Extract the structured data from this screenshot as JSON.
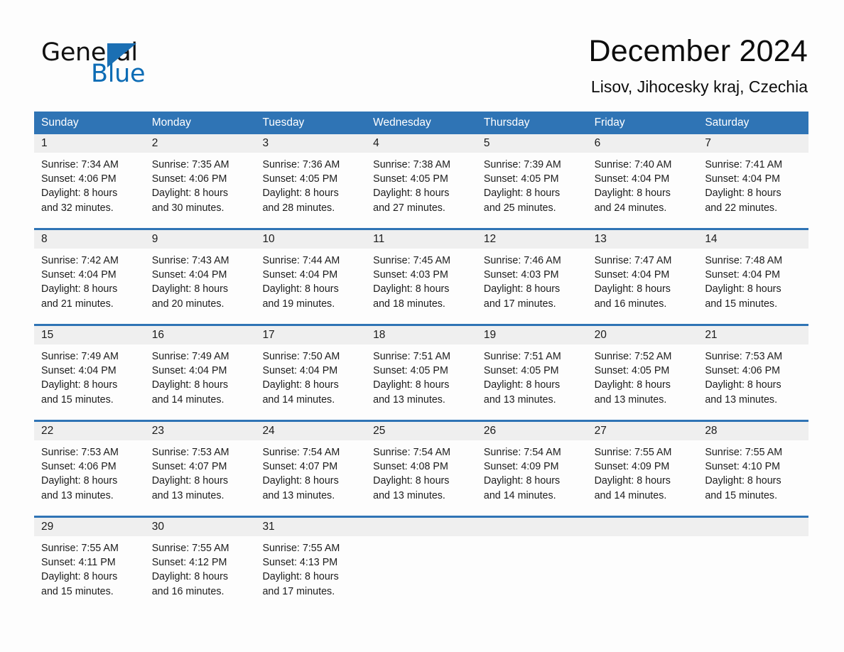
{
  "brand": {
    "name_part1": "General",
    "name_part2": "Blue",
    "triangle_color": "#1b6fb3",
    "blue_color": "#0d6cb5"
  },
  "header": {
    "month_title": "December 2024",
    "location": "Lisov, Jihocesky kraj, Czechia"
  },
  "theme": {
    "header_blue": "#2f74b5",
    "row_divider_blue": "#2f74b5",
    "daynum_strip_gray": "#efefef",
    "page_background": "#fdfdfd",
    "text_color": "#1c1c1c"
  },
  "calendar": {
    "weekday_headers": [
      "Sunday",
      "Monday",
      "Tuesday",
      "Wednesday",
      "Thursday",
      "Friday",
      "Saturday"
    ],
    "weeks": [
      [
        {
          "day": "1",
          "sunrise": "Sunrise: 7:34 AM",
          "sunset": "Sunset: 4:06 PM",
          "daylight_line1": "Daylight: 8 hours",
          "daylight_line2": "and 32 minutes."
        },
        {
          "day": "2",
          "sunrise": "Sunrise: 7:35 AM",
          "sunset": "Sunset: 4:06 PM",
          "daylight_line1": "Daylight: 8 hours",
          "daylight_line2": "and 30 minutes."
        },
        {
          "day": "3",
          "sunrise": "Sunrise: 7:36 AM",
          "sunset": "Sunset: 4:05 PM",
          "daylight_line1": "Daylight: 8 hours",
          "daylight_line2": "and 28 minutes."
        },
        {
          "day": "4",
          "sunrise": "Sunrise: 7:38 AM",
          "sunset": "Sunset: 4:05 PM",
          "daylight_line1": "Daylight: 8 hours",
          "daylight_line2": "and 27 minutes."
        },
        {
          "day": "5",
          "sunrise": "Sunrise: 7:39 AM",
          "sunset": "Sunset: 4:05 PM",
          "daylight_line1": "Daylight: 8 hours",
          "daylight_line2": "and 25 minutes."
        },
        {
          "day": "6",
          "sunrise": "Sunrise: 7:40 AM",
          "sunset": "Sunset: 4:04 PM",
          "daylight_line1": "Daylight: 8 hours",
          "daylight_line2": "and 24 minutes."
        },
        {
          "day": "7",
          "sunrise": "Sunrise: 7:41 AM",
          "sunset": "Sunset: 4:04 PM",
          "daylight_line1": "Daylight: 8 hours",
          "daylight_line2": "and 22 minutes."
        }
      ],
      [
        {
          "day": "8",
          "sunrise": "Sunrise: 7:42 AM",
          "sunset": "Sunset: 4:04 PM",
          "daylight_line1": "Daylight: 8 hours",
          "daylight_line2": "and 21 minutes."
        },
        {
          "day": "9",
          "sunrise": "Sunrise: 7:43 AM",
          "sunset": "Sunset: 4:04 PM",
          "daylight_line1": "Daylight: 8 hours",
          "daylight_line2": "and 20 minutes."
        },
        {
          "day": "10",
          "sunrise": "Sunrise: 7:44 AM",
          "sunset": "Sunset: 4:04 PM",
          "daylight_line1": "Daylight: 8 hours",
          "daylight_line2": "and 19 minutes."
        },
        {
          "day": "11",
          "sunrise": "Sunrise: 7:45 AM",
          "sunset": "Sunset: 4:03 PM",
          "daylight_line1": "Daylight: 8 hours",
          "daylight_line2": "and 18 minutes."
        },
        {
          "day": "12",
          "sunrise": "Sunrise: 7:46 AM",
          "sunset": "Sunset: 4:03 PM",
          "daylight_line1": "Daylight: 8 hours",
          "daylight_line2": "and 17 minutes."
        },
        {
          "day": "13",
          "sunrise": "Sunrise: 7:47 AM",
          "sunset": "Sunset: 4:04 PM",
          "daylight_line1": "Daylight: 8 hours",
          "daylight_line2": "and 16 minutes."
        },
        {
          "day": "14",
          "sunrise": "Sunrise: 7:48 AM",
          "sunset": "Sunset: 4:04 PM",
          "daylight_line1": "Daylight: 8 hours",
          "daylight_line2": "and 15 minutes."
        }
      ],
      [
        {
          "day": "15",
          "sunrise": "Sunrise: 7:49 AM",
          "sunset": "Sunset: 4:04 PM",
          "daylight_line1": "Daylight: 8 hours",
          "daylight_line2": "and 15 minutes."
        },
        {
          "day": "16",
          "sunrise": "Sunrise: 7:49 AM",
          "sunset": "Sunset: 4:04 PM",
          "daylight_line1": "Daylight: 8 hours",
          "daylight_line2": "and 14 minutes."
        },
        {
          "day": "17",
          "sunrise": "Sunrise: 7:50 AM",
          "sunset": "Sunset: 4:04 PM",
          "daylight_line1": "Daylight: 8 hours",
          "daylight_line2": "and 14 minutes."
        },
        {
          "day": "18",
          "sunrise": "Sunrise: 7:51 AM",
          "sunset": "Sunset: 4:05 PM",
          "daylight_line1": "Daylight: 8 hours",
          "daylight_line2": "and 13 minutes."
        },
        {
          "day": "19",
          "sunrise": "Sunrise: 7:51 AM",
          "sunset": "Sunset: 4:05 PM",
          "daylight_line1": "Daylight: 8 hours",
          "daylight_line2": "and 13 minutes."
        },
        {
          "day": "20",
          "sunrise": "Sunrise: 7:52 AM",
          "sunset": "Sunset: 4:05 PM",
          "daylight_line1": "Daylight: 8 hours",
          "daylight_line2": "and 13 minutes."
        },
        {
          "day": "21",
          "sunrise": "Sunrise: 7:53 AM",
          "sunset": "Sunset: 4:06 PM",
          "daylight_line1": "Daylight: 8 hours",
          "daylight_line2": "and 13 minutes."
        }
      ],
      [
        {
          "day": "22",
          "sunrise": "Sunrise: 7:53 AM",
          "sunset": "Sunset: 4:06 PM",
          "daylight_line1": "Daylight: 8 hours",
          "daylight_line2": "and 13 minutes."
        },
        {
          "day": "23",
          "sunrise": "Sunrise: 7:53 AM",
          "sunset": "Sunset: 4:07 PM",
          "daylight_line1": "Daylight: 8 hours",
          "daylight_line2": "and 13 minutes."
        },
        {
          "day": "24",
          "sunrise": "Sunrise: 7:54 AM",
          "sunset": "Sunset: 4:07 PM",
          "daylight_line1": "Daylight: 8 hours",
          "daylight_line2": "and 13 minutes."
        },
        {
          "day": "25",
          "sunrise": "Sunrise: 7:54 AM",
          "sunset": "Sunset: 4:08 PM",
          "daylight_line1": "Daylight: 8 hours",
          "daylight_line2": "and 13 minutes."
        },
        {
          "day": "26",
          "sunrise": "Sunrise: 7:54 AM",
          "sunset": "Sunset: 4:09 PM",
          "daylight_line1": "Daylight: 8 hours",
          "daylight_line2": "and 14 minutes."
        },
        {
          "day": "27",
          "sunrise": "Sunrise: 7:55 AM",
          "sunset": "Sunset: 4:09 PM",
          "daylight_line1": "Daylight: 8 hours",
          "daylight_line2": "and 14 minutes."
        },
        {
          "day": "28",
          "sunrise": "Sunrise: 7:55 AM",
          "sunset": "Sunset: 4:10 PM",
          "daylight_line1": "Daylight: 8 hours",
          "daylight_line2": "and 15 minutes."
        }
      ],
      [
        {
          "day": "29",
          "sunrise": "Sunrise: 7:55 AM",
          "sunset": "Sunset: 4:11 PM",
          "daylight_line1": "Daylight: 8 hours",
          "daylight_line2": "and 15 minutes."
        },
        {
          "day": "30",
          "sunrise": "Sunrise: 7:55 AM",
          "sunset": "Sunset: 4:12 PM",
          "daylight_line1": "Daylight: 8 hours",
          "daylight_line2": "and 16 minutes."
        },
        {
          "day": "31",
          "sunrise": "Sunrise: 7:55 AM",
          "sunset": "Sunset: 4:13 PM",
          "daylight_line1": "Daylight: 8 hours",
          "daylight_line2": "and 17 minutes."
        },
        {
          "day": "",
          "sunrise": "",
          "sunset": "",
          "daylight_line1": "",
          "daylight_line2": ""
        },
        {
          "day": "",
          "sunrise": "",
          "sunset": "",
          "daylight_line1": "",
          "daylight_line2": ""
        },
        {
          "day": "",
          "sunrise": "",
          "sunset": "",
          "daylight_line1": "",
          "daylight_line2": ""
        },
        {
          "day": "",
          "sunrise": "",
          "sunset": "",
          "daylight_line1": "",
          "daylight_line2": ""
        }
      ]
    ]
  }
}
